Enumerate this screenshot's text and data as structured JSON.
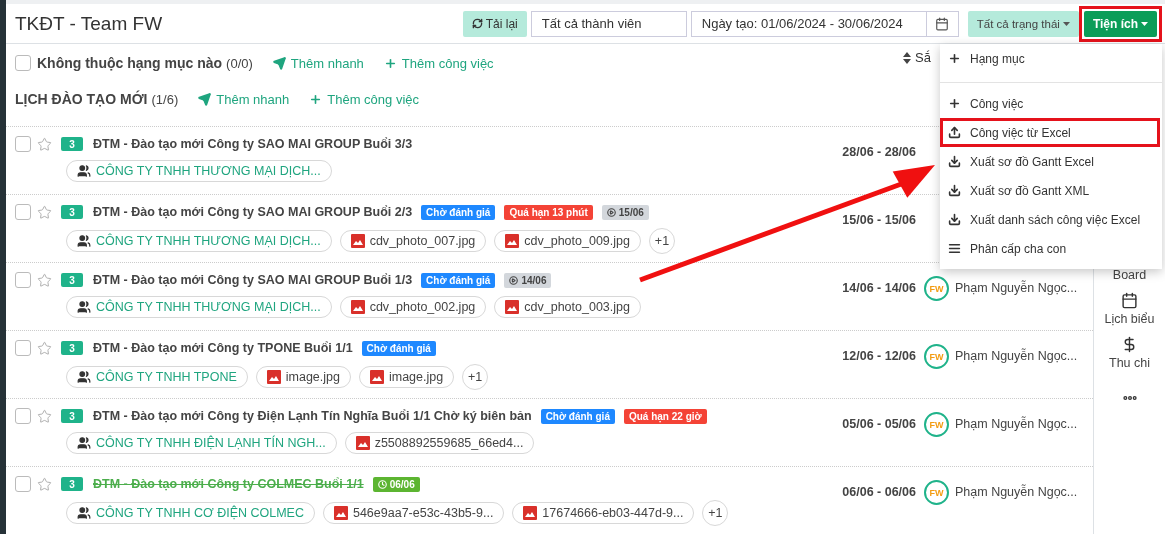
{
  "header": {
    "title": "TKĐT - Team FW",
    "reload_button": "Tải lại",
    "member_filter": {
      "value": "Tất cả thành viên"
    },
    "date_filter": {
      "value": "Ngày tạo: 01/06/2024 - 30/06/2024"
    },
    "status_filter": "Tất cả trạng thái",
    "utility_button": {
      "label": "Tiện ích",
      "highlighted": true
    }
  },
  "sort_label": "Sắ",
  "groups": [
    {
      "title": "Không thuộc hạng mục nào",
      "count": "(0/0)",
      "checkbox": {
        "checked": false
      },
      "actions": [
        "Thêm nhanh",
        "Thêm công việc"
      ]
    },
    {
      "title": "LỊCH ĐÀO TẠO MỚI",
      "count": "(1/6)",
      "actions": [
        "Thêm nhanh",
        "Thêm công việc"
      ]
    }
  ],
  "rows": [
    {
      "checked": false,
      "starred": false,
      "count": "3",
      "title": "ĐTM - Đào tạo mới Công ty SAO MAI GROUP Buổi 3/3",
      "done": false,
      "tags": [],
      "chips": [
        {
          "kind": "customer",
          "text": "CÔNG TY TNHH THƯƠNG MẠI DỊCH..."
        }
      ],
      "dates": "28/06 - 28/06"
    },
    {
      "checked": false,
      "starred": false,
      "count": "3",
      "title": "ĐTM - Đào tạo mới Công ty SAO MAI GROUP Buổi 2/3",
      "done": false,
      "tags": [
        {
          "kind": "status",
          "text": "Chờ đánh giá"
        },
        {
          "kind": "overdue",
          "text": "Quá hạn 13 phút"
        },
        {
          "kind": "start",
          "text": "15/06"
        }
      ],
      "chips": [
        {
          "kind": "customer",
          "text": "CÔNG TY TNHH THƯƠNG MẠI DỊCH..."
        },
        {
          "kind": "file",
          "text": "cdv_photo_007.jpg"
        },
        {
          "kind": "file",
          "text": "cdv_photo_009.jpg"
        },
        {
          "kind": "more",
          "text": "+1"
        }
      ],
      "dates": "15/06 - 15/06"
    },
    {
      "checked": false,
      "starred": false,
      "count": "3",
      "title": "ĐTM - Đào tạo mới Công ty SAO MAI GROUP Buổi 1/3",
      "done": false,
      "tags": [
        {
          "kind": "status",
          "text": "Chờ đánh giá"
        },
        {
          "kind": "start",
          "text": "14/06"
        }
      ],
      "chips": [
        {
          "kind": "customer",
          "text": "CÔNG TY TNHH THƯƠNG MẠI DỊCH..."
        },
        {
          "kind": "file",
          "text": "cdv_photo_002.jpg"
        },
        {
          "kind": "file",
          "text": "cdv_photo_003.jpg"
        }
      ],
      "dates": "14/06 - 14/06",
      "avatar": "FW",
      "assignee": "Phạm Nguyễn Ngọc..."
    },
    {
      "checked": false,
      "starred": false,
      "count": "3",
      "title": "ĐTM - Đào tạo mới Công ty TPONE Buổi 1/1",
      "done": false,
      "tags": [
        {
          "kind": "status",
          "text": "Chờ đánh giá"
        }
      ],
      "chips": [
        {
          "kind": "customer",
          "text": "CÔNG TY TNHH TPONE"
        },
        {
          "kind": "file",
          "text": "image.jpg"
        },
        {
          "kind": "file",
          "text": "image.jpg"
        },
        {
          "kind": "more",
          "text": "+1"
        }
      ],
      "dates": "12/06 - 12/06",
      "avatar": "FW",
      "assignee": "Phạm Nguyễn Ngọc..."
    },
    {
      "checked": false,
      "starred": false,
      "count": "3",
      "title": "ĐTM - Đào tạo mới Công ty Điện Lạnh Tín Nghĩa Buổi 1/1 Chờ ký biên bản",
      "done": false,
      "tags": [
        {
          "kind": "status",
          "text": "Chờ đánh giá"
        },
        {
          "kind": "overdue",
          "text": "Quá hạn 22 giờ"
        }
      ],
      "chips": [
        {
          "kind": "customer",
          "text": "CÔNG TY TNHH ĐIỆN LẠNH TÍN NGH..."
        },
        {
          "kind": "file",
          "text": "z5508892559685_66ed4..."
        }
      ],
      "dates": "05/06 - 05/06",
      "avatar": "FW",
      "assignee": "Phạm Nguyễn Ngọc..."
    },
    {
      "checked": false,
      "starred": false,
      "count": "3",
      "title": "ĐTM - Đào tạo mới Công ty COLMEC Buổi 1/1",
      "done": true,
      "tags": [
        {
          "kind": "finished",
          "text": "06/06"
        }
      ],
      "chips": [
        {
          "kind": "customer",
          "text": "CÔNG TY TNHH CƠ ĐIỆN COLMEC"
        },
        {
          "kind": "file",
          "text": "546e9aa7-e53c-43b5-9..."
        },
        {
          "kind": "file",
          "text": "17674666-eb03-447d-9..."
        },
        {
          "kind": "more",
          "text": "+1"
        }
      ],
      "dates": "06/06 - 06/06",
      "avatar": "FW",
      "assignee": "Phạm Nguyễn Ngọc..."
    }
  ],
  "sidebar": [
    {
      "kind": "board",
      "label": "Board"
    },
    {
      "kind": "calendar",
      "label": "Lịch biểu"
    },
    {
      "kind": "money",
      "label": "Thu chi"
    },
    {
      "kind": "more"
    }
  ],
  "menu": {
    "items": [
      {
        "kind": "add",
        "label": "Hạng mục",
        "highlighted": false
      },
      {
        "kind": "divider"
      },
      {
        "kind": "add",
        "label": "Công việc",
        "highlighted": false
      },
      {
        "kind": "upload",
        "label": "Công việc từ Excel",
        "highlighted": true
      },
      {
        "kind": "download",
        "label": "Xuất sơ đồ Gantt Excel",
        "highlighted": false
      },
      {
        "kind": "download",
        "label": "Xuất sơ đồ Gantt XML",
        "highlighted": false
      },
      {
        "kind": "download",
        "label": "Xuất danh sách công việc Excel",
        "highlighted": false
      },
      {
        "kind": "hierarchy",
        "label": "Phân cấp cha con",
        "highlighted": false
      }
    ]
  }
}
